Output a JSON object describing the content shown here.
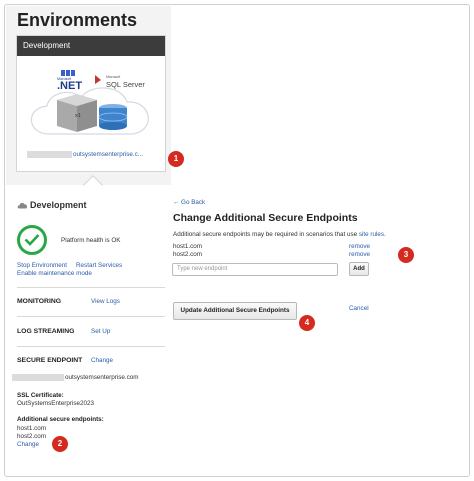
{
  "page": {
    "title": "Environments"
  },
  "env_card": {
    "header": "Development",
    "dotnet_small": "Microsoft",
    "dotnet_big": ".NET",
    "sql_small": "Microsoft",
    "sql_big": "SQL Server",
    "multiplier": "x1",
    "url_suffix": "outsystemsenterprise.c..."
  },
  "details": {
    "env_name": "Development",
    "health_text": "Platform health is OK",
    "stop_link": "Stop Environment",
    "restart_link": "Restart Services",
    "maintenance_link": "Enable maintenance mode",
    "monitoring_label": "MONITORING",
    "view_logs": "View Logs",
    "log_streaming_label": "LOG STREAMING",
    "setup_link": "Set Up",
    "secure_endpoint_label": "SECURE ENDPOINT",
    "secure_change": "Change",
    "secure_host_suffix": "outsystemsenterprise.com",
    "ssl_label": "SSL Certificate:",
    "ssl_value": "OutSystemsEnterprise2023",
    "additional_label": "Additional secure endpoints:",
    "hosts": [
      "host1.com",
      "host2.com"
    ],
    "additional_change": "Change"
  },
  "form": {
    "go_back": "Go Back",
    "title": "Change Additional Secure Endpoints",
    "desc_text": "Additional secure endpoints may be required in scenarios that use ",
    "desc_link": "site rules",
    "desc_end": ".",
    "endpoints": [
      {
        "host": "host1.com",
        "action": "remove"
      },
      {
        "host": "host2.com",
        "action": "remove"
      }
    ],
    "new_placeholder": "Type new endpoint",
    "add_button": "Add",
    "update_button": "Update Additional Secure Endpoints",
    "cancel_link": "Cancel"
  },
  "badges": [
    "1",
    "2",
    "3",
    "4"
  ],
  "colors": {
    "badge": "#d42a1f",
    "link": "#2a5ca8",
    "health": "#27a844",
    "card_header": "#3c3c3c"
  }
}
